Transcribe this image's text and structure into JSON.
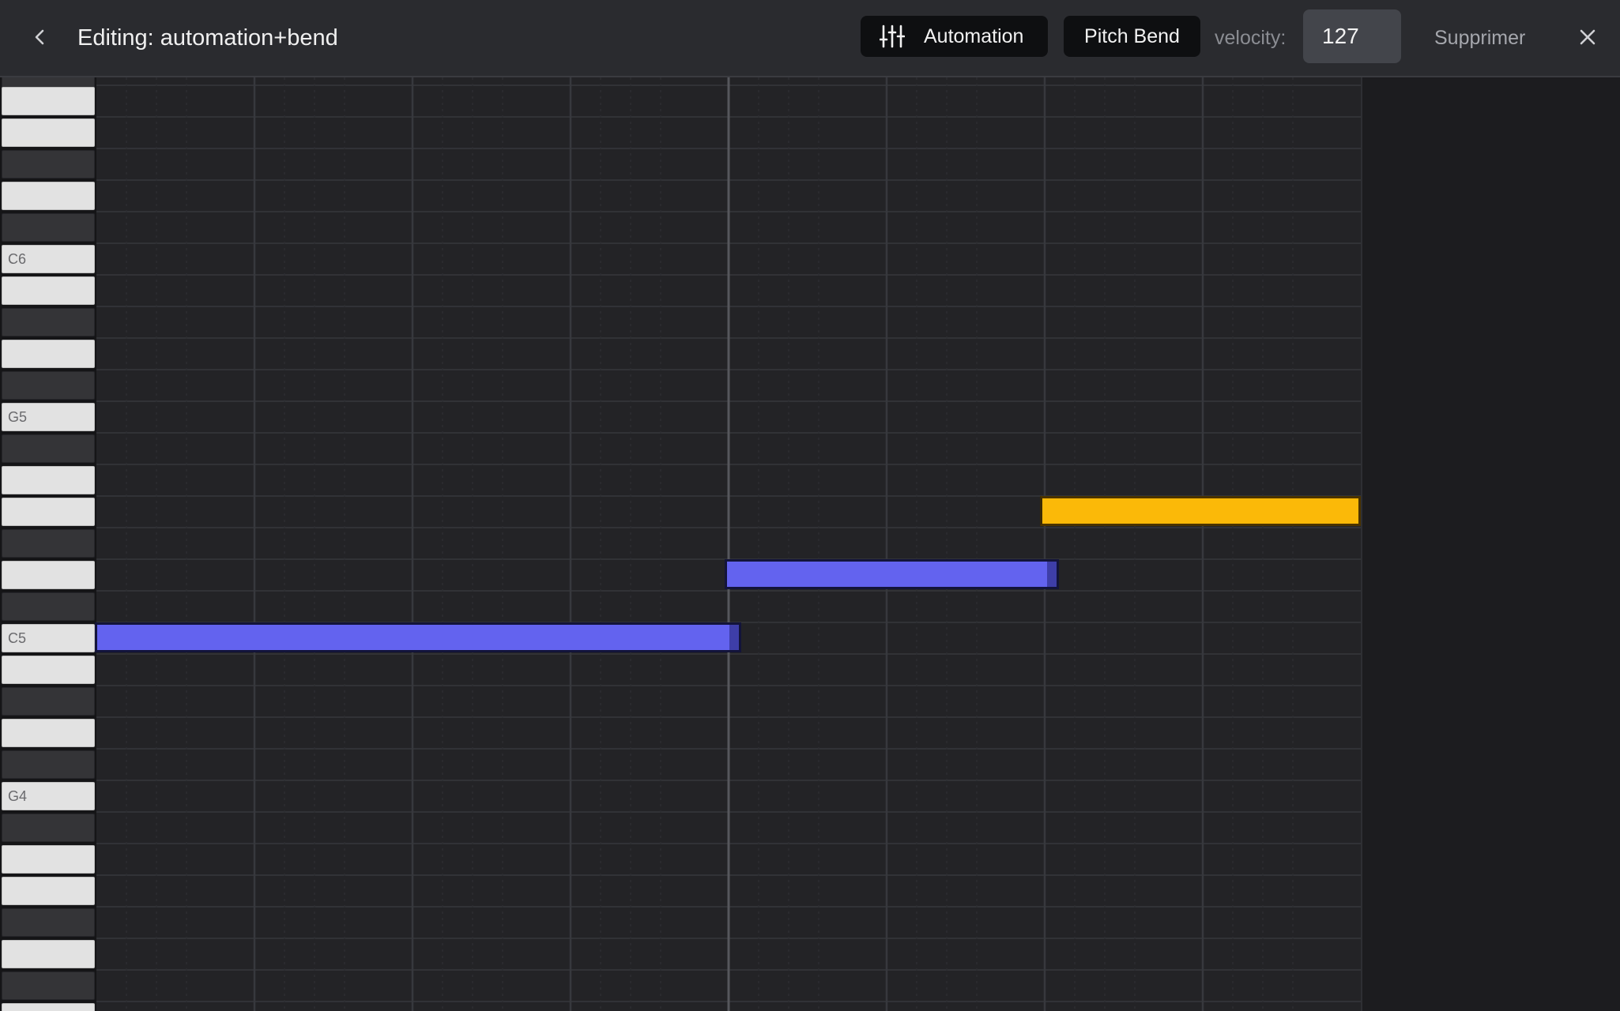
{
  "header": {
    "title": "Editing: automation+bend",
    "automation_label": "Automation",
    "pitch_bend_label": "Pitch Bend",
    "velocity_label": "velocity:",
    "velocity_value": "127",
    "delete_label": "Supprimer"
  },
  "icons": {
    "back": "chevron-left-icon",
    "automation": "sliders-icon",
    "close": "close-icon"
  },
  "colors": {
    "note_default": "#6363ef",
    "note_selected": "#fbb908",
    "playhead": "#56575c"
  },
  "piano": {
    "labels": {
      "c6": "C6",
      "g5": "G5",
      "c5": "C5",
      "g4": "G4"
    }
  }
}
